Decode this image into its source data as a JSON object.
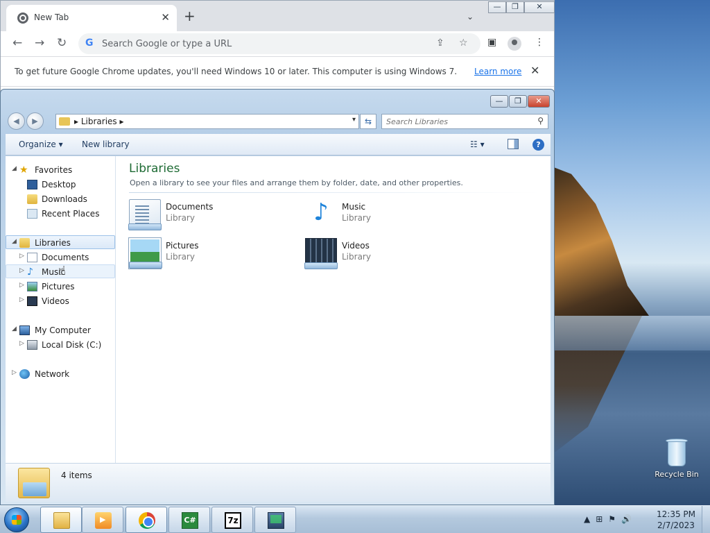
{
  "desktop": {
    "recycle_bin_label": "Recycle Bin"
  },
  "chrome": {
    "tab_title": "New Tab",
    "tab_close": "✕",
    "new_tab": "+",
    "tab_search": "⌄",
    "caption": {
      "minimize": "—",
      "restore": "❐",
      "close": "✕"
    },
    "toolbar": {
      "back": "←",
      "forward": "→",
      "reload": "↻",
      "sidepanel": "▣",
      "menu": "⋮"
    },
    "omnibox": {
      "g": "G",
      "placeholder": "Search Google or type a URL",
      "share": "⇪",
      "star": "☆"
    },
    "infobar": {
      "message": "To get future Google Chrome updates, you'll need Windows 10 or later. This computer is using Windows 7.",
      "link": "Learn more",
      "close": "✕"
    }
  },
  "explorer": {
    "caption": {
      "minimize": "—",
      "restore": "❐",
      "close": "✕"
    },
    "back": "◀",
    "forward": "▶",
    "breadcrumb": "▸  Libraries  ▸",
    "address_dropdown": "▾",
    "refresh": "⇆",
    "search_placeholder": "Search Libraries",
    "search_icon": "⚲",
    "commands": {
      "organize": "Organize ▾",
      "new_library": "New library",
      "views": "☷ ▾",
      "help": "?"
    },
    "nav": {
      "favorites": "Favorites",
      "desktop": "Desktop",
      "downloads": "Downloads",
      "recent_places": "Recent Places",
      "libraries": "Libraries",
      "documents": "Documents",
      "music": "Music",
      "pictures": "Pictures",
      "videos": "Videos",
      "my_computer": "My Computer",
      "local_disk": "Local Disk (C:)",
      "network": "Network"
    },
    "arrows": {
      "expanded": "◢",
      "collapsed": "▷"
    },
    "content": {
      "heading": "Libraries",
      "subtitle": "Open a library to see your files and arrange them by folder, date, and other properties.",
      "libraries": [
        {
          "name": "Documents",
          "type": "Library"
        },
        {
          "name": "Music",
          "type": "Library"
        },
        {
          "name": "Pictures",
          "type": "Library"
        },
        {
          "name": "Videos",
          "type": "Library"
        }
      ],
      "music_note": "♪"
    },
    "details": {
      "count": "4 items"
    }
  },
  "taskbar": {
    "apps": {
      "cs": "C#",
      "sevenzip": "7z"
    },
    "tray": {
      "arrow": "▲",
      "network": "⊞",
      "flag": "⚑",
      "volume": "🔊"
    },
    "clock_time": "12:35 PM",
    "clock_date": "2/7/2023"
  },
  "cursor": "☝"
}
